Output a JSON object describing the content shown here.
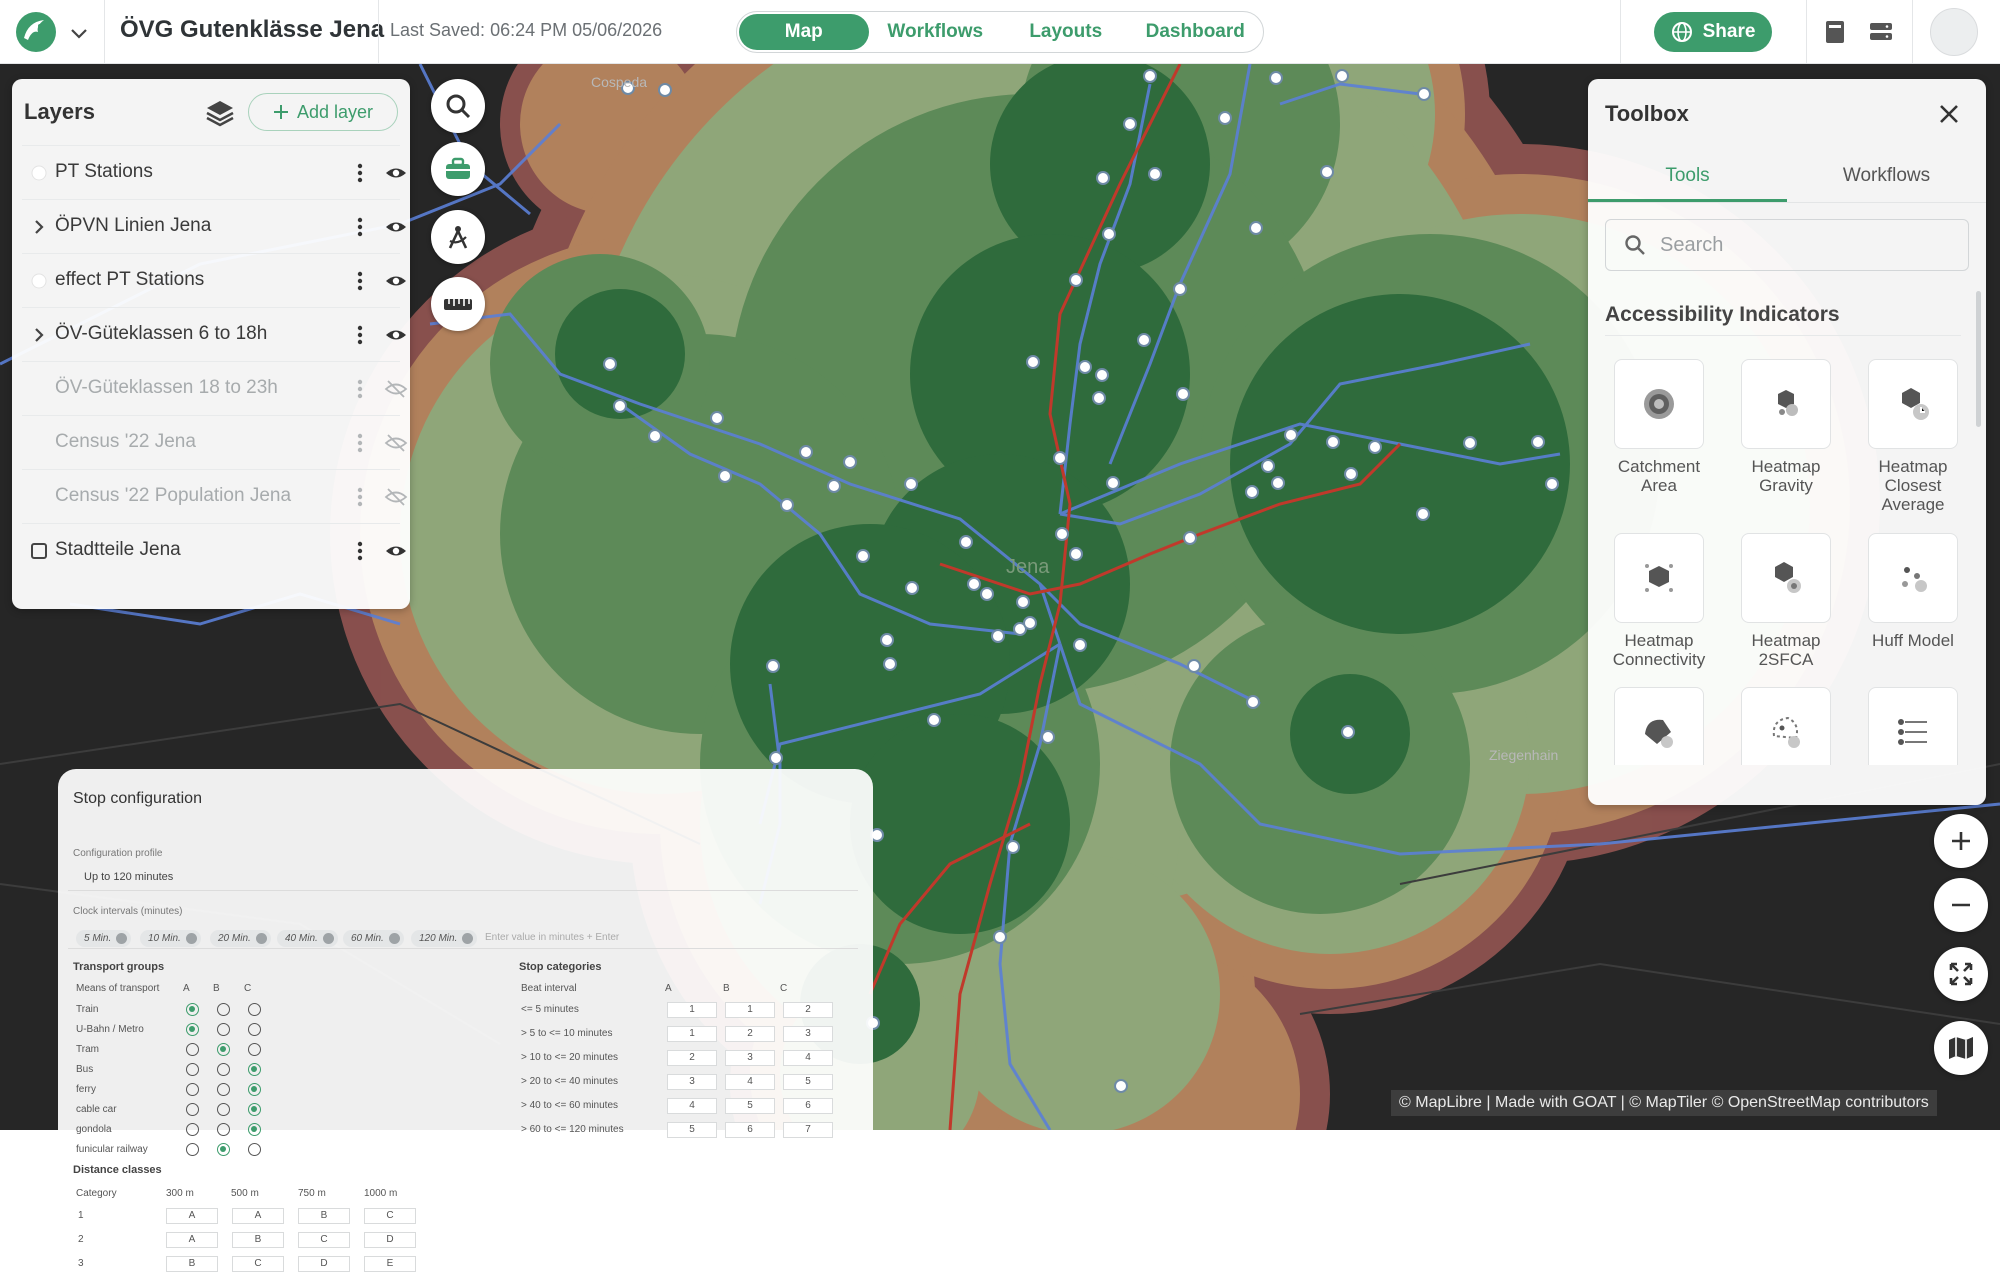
{
  "header": {
    "project_title": "ÖVG Gutenklässe Jena",
    "last_saved": "Last Saved: 06:24 PM 05/06/2026",
    "nav_tabs": [
      "Map",
      "Workflows",
      "Layouts",
      "Dashboard"
    ],
    "active_tab": "Map",
    "share_label": "Share",
    "accent_color": "#3d9c6c"
  },
  "layers_panel": {
    "title": "Layers",
    "add_layer_label": "Add layer",
    "layers": [
      {
        "name": "PT Stations",
        "lead": "dot",
        "visible": true
      },
      {
        "name": "ÖPVN Linien Jena",
        "lead": "chevron",
        "visible": true
      },
      {
        "name": "effect PT Stations",
        "lead": "dot",
        "visible": true
      },
      {
        "name": "ÖV-Güteklassen 6 to 18h",
        "lead": "chevron",
        "visible": true
      },
      {
        "name": "ÖV-Güteklassen 18 to 23h",
        "lead": "none",
        "visible": false
      },
      {
        "name": "Census '22 Jena",
        "lead": "none",
        "visible": false
      },
      {
        "name": "Census '22 Population Jena",
        "lead": "none",
        "visible": false
      },
      {
        "name": "Stadtteile Jena",
        "lead": "checkbox",
        "visible": true
      }
    ]
  },
  "map_tools": [
    "search-icon",
    "toolbox-icon",
    "draw-icon",
    "ruler-icon"
  ],
  "map_labels": {
    "city": "Jena",
    "north": "Cospeda",
    "east": "Ziegenhain"
  },
  "toolbox": {
    "title": "Toolbox",
    "tabs": [
      "Tools",
      "Workflows"
    ],
    "active_tab": "Tools",
    "search_placeholder": "Search",
    "section": "Accessibility Indicators",
    "tools": [
      "Catchment Area",
      "Heatmap Gravity",
      "Heatmap Closest Average",
      "Heatmap Connectivity",
      "Heatmap 2SFCA",
      "Huff Model",
      "",
      "",
      ""
    ]
  },
  "map_controls": [
    "zoom-in-icon",
    "zoom-out-icon",
    "fullscreen-icon",
    "basemap-icon"
  ],
  "attribution": "© MapLibre | Made with GOAT | © MapTiler © OpenStreetMap contributors",
  "stop_configuration": {
    "title": "Stop configuration",
    "profile_label": "Configuration profile",
    "profile_value": "Up to 120 minutes",
    "intervals_label": "Clock intervals (minutes)",
    "intervals": [
      "5 Min.",
      "10 Min.",
      "20 Min.",
      "40 Min.",
      "60 Min.",
      "120 Min."
    ],
    "intervals_placeholder": "Enter value in minutes + Enter",
    "transport_groups_title": "Transport groups",
    "transport_header": [
      "Means of transport",
      "A",
      "B",
      "C"
    ],
    "transport_modes": [
      {
        "name": "Train",
        "group": "A"
      },
      {
        "name": "U-Bahn / Metro",
        "group": "A"
      },
      {
        "name": "Tram",
        "group": "B"
      },
      {
        "name": "Bus",
        "group": "C"
      },
      {
        "name": "ferry",
        "group": "C"
      },
      {
        "name": "cable car",
        "group": "C"
      },
      {
        "name": "gondola",
        "group": "C"
      },
      {
        "name": "funicular railway",
        "group": "B"
      }
    ],
    "stop_categories_title": "Stop categories",
    "stop_header": [
      "Beat interval",
      "A",
      "B",
      "C"
    ],
    "stop_categories": [
      {
        "interval": "<= 5 minutes",
        "values": [
          "1",
          "1",
          "2"
        ]
      },
      {
        "interval": "> 5 to <= 10 minutes",
        "values": [
          "1",
          "2",
          "3"
        ]
      },
      {
        "interval": "> 10 to <= 20 minutes",
        "values": [
          "2",
          "3",
          "4"
        ]
      },
      {
        "interval": "> 20 to <= 40 minutes",
        "values": [
          "3",
          "4",
          "5"
        ]
      },
      {
        "interval": "> 40 to <= 60 minutes",
        "values": [
          "4",
          "5",
          "6"
        ]
      },
      {
        "interval": "> 60 to <= 120 minutes",
        "values": [
          "5",
          "6",
          "7"
        ]
      }
    ],
    "distance_title": "Distance classes",
    "distance_header": [
      "Category",
      "300 m",
      "500 m",
      "750 m",
      "1000 m"
    ],
    "distance_rows": [
      {
        "category": "1",
        "values": [
          "A",
          "A",
          "B",
          "C"
        ]
      },
      {
        "category": "2",
        "values": [
          "A",
          "B",
          "C",
          "D"
        ]
      },
      {
        "category": "3",
        "values": [
          "B",
          "C",
          "D",
          "E"
        ]
      }
    ]
  }
}
